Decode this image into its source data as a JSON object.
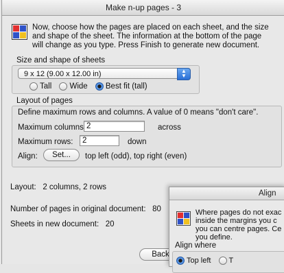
{
  "window": {
    "title": "Make n-up pages - 3"
  },
  "intro": {
    "line1": "Now, choose how the pages are placed on each sheet, and the size",
    "line2": "and shape of the sheet. The information at the bottom of the page",
    "line3": "will change as you type. Press Finish to generate new document."
  },
  "size_group": {
    "label": "Size and shape of sheets",
    "selected_size": "9 x 12 (9.00 x 12.00 in)",
    "radio": [
      {
        "label": "Tall",
        "checked": false
      },
      {
        "label": "Wide",
        "checked": false
      },
      {
        "label": "Best fit (tall)",
        "checked": true
      }
    ]
  },
  "layout_group": {
    "label": "Layout of pages",
    "description": "Define maximum rows and columns. A value of 0 means \"don't care\".",
    "max_columns_label": "Maximum columns:",
    "max_columns_value": "2",
    "max_columns_suffix": "across",
    "max_rows_label": "Maximum rows:",
    "max_rows_value": "2",
    "max_rows_suffix": "down",
    "align_label": "Align:",
    "set_button": "Set...",
    "align_value": "top left (odd), top right (even)"
  },
  "summary": {
    "layout_label": "Layout:",
    "layout_value": "2 columns, 2 rows",
    "original_pages_label": "Number of pages in original document:",
    "original_pages_value": "80",
    "sheets_label": "Sheets in new document:",
    "sheets_value": "20"
  },
  "buttons": {
    "back": "Back"
  },
  "align_dialog": {
    "title": "Align",
    "text_line1": "Where pages do not exac",
    "text_line2": "inside the margins you c",
    "text_line3": "you can centre pages. Ce",
    "text_line4": "you define.",
    "group_label": "Align where",
    "radio1": "Top left",
    "radio2": "T"
  },
  "colors": {
    "accent": "#2a6fd6",
    "window_bg": "#e8e8e8"
  }
}
